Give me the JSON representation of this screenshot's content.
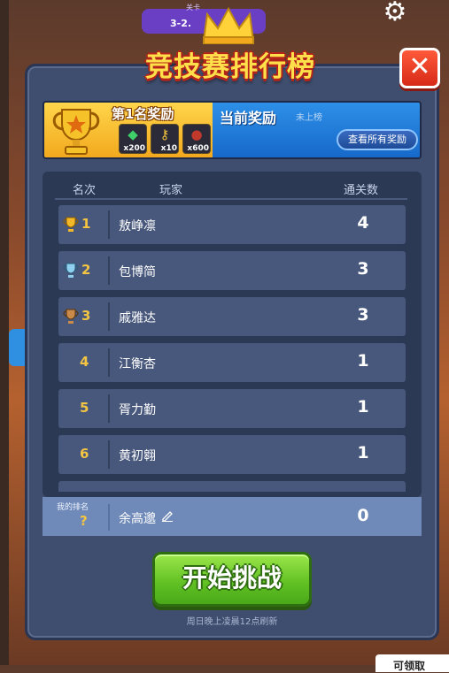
{
  "background": {
    "stage_tag": "关卡",
    "stage_label": "3-2.",
    "corner_tag": "可领取"
  },
  "dialog": {
    "title": "竞技赛排行榜",
    "close_label": "✕"
  },
  "reward": {
    "first_place_label": "第1名奖励",
    "items": [
      {
        "icon": "green-gem-icon",
        "glyph": "◆",
        "color": "#3fd06a",
        "count": "x200"
      },
      {
        "icon": "key-icon",
        "glyph": "⚷",
        "color": "#f2c23a",
        "count": "x10"
      },
      {
        "icon": "coin-bag-icon",
        "glyph": "●",
        "color": "#c0392b",
        "count": "x600"
      }
    ],
    "current_label": "当前奖励",
    "current_status": "未上榜",
    "view_all_label": "查看所有奖励"
  },
  "table": {
    "headers": {
      "rank": "名次",
      "player": "玩家",
      "score": "通关数"
    },
    "rows": [
      {
        "rank": "1",
        "cup": "gold",
        "name": "敖峥凛",
        "score": "4"
      },
      {
        "rank": "2",
        "cup": "silver",
        "name": "包博简",
        "score": "3"
      },
      {
        "rank": "3",
        "cup": "bronze",
        "name": "戚雅达",
        "score": "3"
      },
      {
        "rank": "4",
        "cup": "",
        "name": "江衡杏",
        "score": "1"
      },
      {
        "rank": "5",
        "cup": "",
        "name": "胥力勤",
        "score": "1"
      },
      {
        "rank": "6",
        "cup": "",
        "name": "黄初翱",
        "score": "1"
      }
    ]
  },
  "my_rank": {
    "label": "我的排名",
    "value": "?",
    "name": "余高邈",
    "score": "0"
  },
  "start_button_label": "开始挑战",
  "refresh_note": "周日晚上凌晨12点刷新",
  "colors": {
    "gold": "#f2b82a",
    "silver": "#8fd0ee",
    "bronze": "#c98a4a"
  }
}
